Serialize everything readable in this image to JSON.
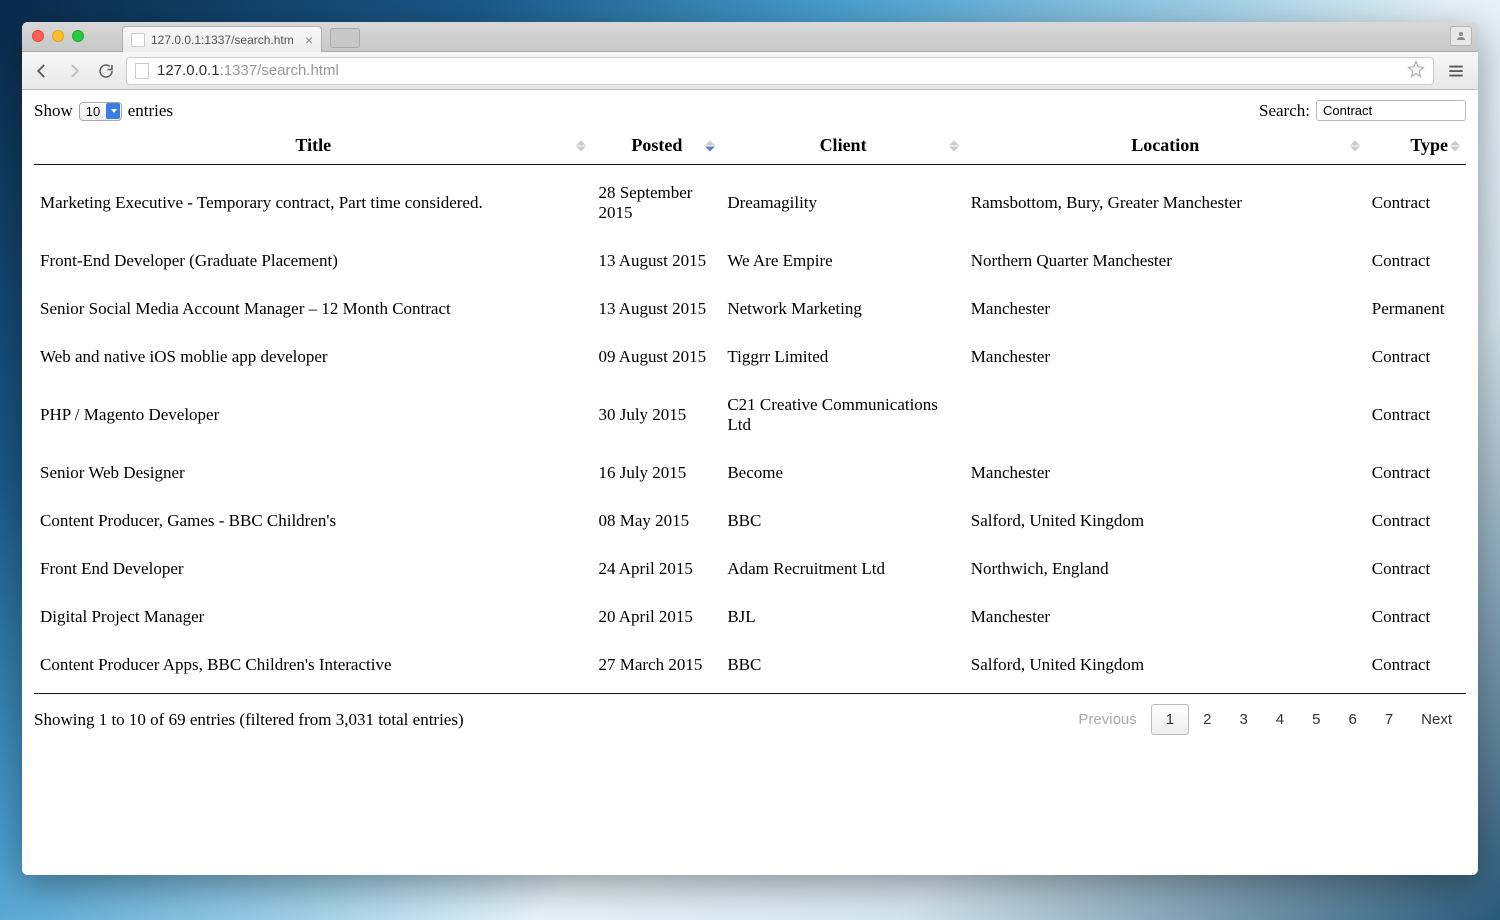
{
  "browser": {
    "tab_title": "127.0.0.1:1337/search.htm",
    "url_host": "127.0.0.1",
    "url_port_path": ":1337/search.html"
  },
  "datatable": {
    "length_label_prefix": "Show",
    "length_label_suffix": "entries",
    "length_value": "10",
    "search_label": "Search:",
    "search_value": "Contract",
    "columns": {
      "title": "Title",
      "posted": "Posted",
      "client": "Client",
      "location": "Location",
      "type": "Type"
    },
    "rows": [
      {
        "title": "Marketing Executive - Temporary contract, Part time considered.",
        "posted": "28 September 2015",
        "client": "Dreamagility",
        "location": "Ramsbottom, Bury, Greater Manchester",
        "type": "Contract"
      },
      {
        "title": "Front-End Developer (Graduate Placement)",
        "posted": "13 August 2015",
        "client": "We Are Empire",
        "location": "Northern Quarter Manchester",
        "type": "Contract"
      },
      {
        "title": "Senior Social Media Account Manager – 12 Month Contract",
        "posted": "13 August 2015",
        "client": "Network Marketing",
        "location": "Manchester",
        "type": "Permanent"
      },
      {
        "title": "Web and native iOS moblie app developer",
        "posted": "09 August 2015",
        "client": "Tiggrr Limited",
        "location": "Manchester",
        "type": "Contract"
      },
      {
        "title": "PHP / Magento Developer",
        "posted": "30 July 2015",
        "client": "C21 Creative Communications Ltd",
        "location": "",
        "type": "Contract"
      },
      {
        "title": "Senior Web Designer",
        "posted": "16 July 2015",
        "client": "Become",
        "location": "Manchester",
        "type": "Contract"
      },
      {
        "title": "Content Producer, Games - BBC Children's",
        "posted": "08 May 2015",
        "client": "BBC",
        "location": "Salford, United Kingdom",
        "type": "Contract"
      },
      {
        "title": "Front End Developer",
        "posted": "24 April 2015",
        "client": "Adam Recruitment Ltd",
        "location": "Northwich, England",
        "type": "Contract"
      },
      {
        "title": "Digital Project Manager",
        "posted": "20 April 2015",
        "client": "BJL",
        "location": "Manchester",
        "type": "Contract"
      },
      {
        "title": "Content Producer Apps, BBC Children's Interactive",
        "posted": "27 March 2015",
        "client": "BBC",
        "location": "Salford, United Kingdom",
        "type": "Contract"
      }
    ],
    "info": "Showing 1 to 10 of 69 entries (filtered from 3,031 total entries)",
    "pagination": {
      "previous": "Previous",
      "next": "Next",
      "pages": [
        "1",
        "2",
        "3",
        "4",
        "5",
        "6",
        "7"
      ],
      "current": "1"
    }
  }
}
